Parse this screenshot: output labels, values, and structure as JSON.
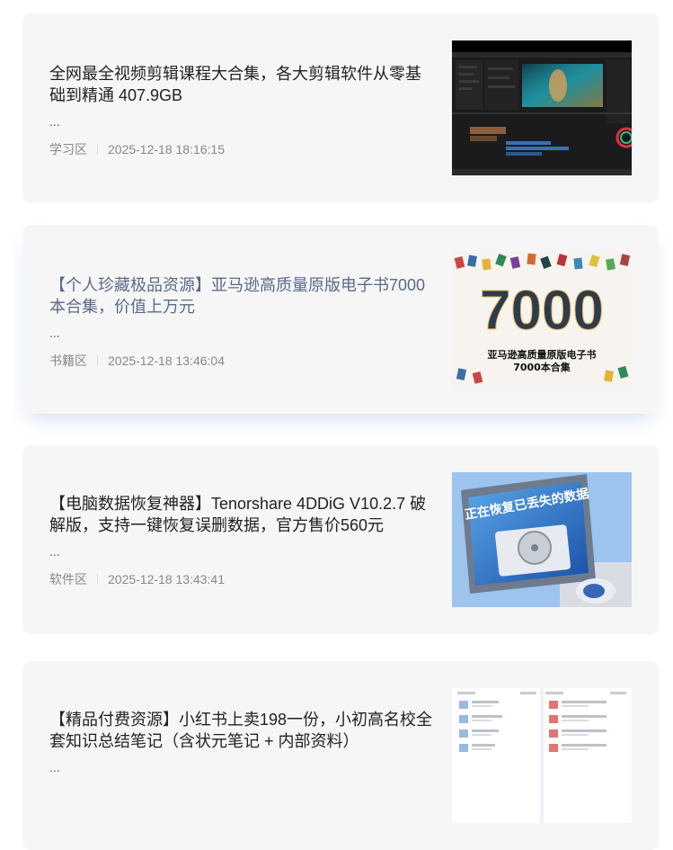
{
  "posts": [
    {
      "title": "全网最全视频剪辑课程大合集，各大剪辑软件从零基础到精通 407.9GB",
      "excerpt": "...",
      "category": "学习区",
      "date": "2025-12-18 18:16:15",
      "thumbnail_icon": "video-editor-screenshot-icon"
    },
    {
      "title": "【个人珍藏极品资源】亚马逊高质量原版电子书7000本合集，价值上万元",
      "excerpt": "...",
      "category": "书籍区",
      "date": "2025-12-18 13:46:04",
      "thumbnail_icon": "books-7000-icon",
      "thumbnail_text": {
        "big_number": "7000",
        "caption_line1": "亚马逊高质量原版电子书",
        "caption_line2": "7000本合集"
      }
    },
    {
      "title": "【电脑数据恢复神器】Tenorshare 4DDiG V10.2.7 破解版，支持一键恢复误删数据，官方售价560元",
      "excerpt": "...",
      "category": "软件区",
      "date": "2025-12-18 13:43:41",
      "thumbnail_icon": "data-recovery-monitor-icon",
      "thumbnail_text": {
        "screen_text": "正在恢复已丢失的数据"
      }
    },
    {
      "title": "【精品付费资源】小红书上卖198一份，小初高名校全套知识总结笔记（含状元笔记 + 内部资料）",
      "excerpt": "...",
      "category": "",
      "date": "",
      "thumbnail_icon": "notes-file-list-icon"
    }
  ],
  "colors": {
    "card_bg": "#f6f6f6",
    "title": "#222222",
    "title_hover": "#5a6a8a",
    "meta": "#888888"
  }
}
